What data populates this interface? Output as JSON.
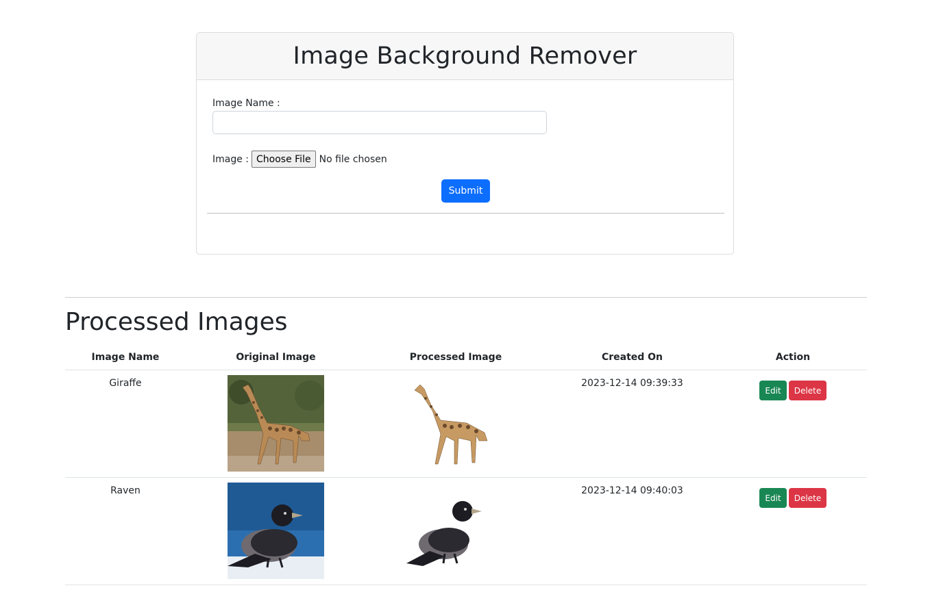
{
  "form": {
    "title": "Image Background Remover",
    "name_label": "Image Name :",
    "name_value": "",
    "image_label": "Image :",
    "choose_file_label": "Choose File",
    "file_status": "No file chosen",
    "submit_label": "Submit"
  },
  "section": {
    "title": "Processed Images"
  },
  "table": {
    "headers": [
      "Image Name",
      "Original Image",
      "Processed Image",
      "Created On",
      "Action"
    ],
    "rows": [
      {
        "name": "Giraffe",
        "original_image": "giraffe-photo",
        "processed_image": "giraffe-cutout",
        "created_on": "2023-12-14 09:39:33",
        "edit_label": "Edit",
        "delete_label": "Delete"
      },
      {
        "name": "Raven",
        "original_image": "raven-photo",
        "processed_image": "raven-cutout",
        "created_on": "2023-12-14 09:40:03",
        "edit_label": "Edit",
        "delete_label": "Delete"
      }
    ]
  },
  "colors": {
    "primary": "#0d6efd",
    "success": "#198754",
    "danger": "#dc3545"
  }
}
